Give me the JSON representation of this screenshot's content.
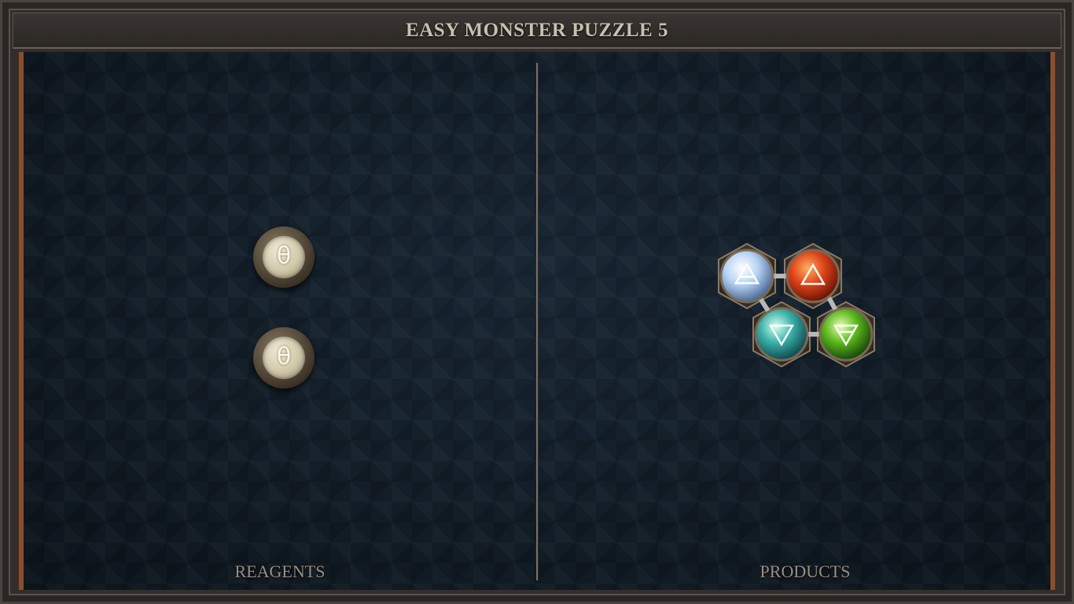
{
  "title": "EASY MONSTER PUZZLE 5",
  "panels": {
    "reagents_label": "REAGENTS",
    "products_label": "PRODUCTS"
  },
  "reagents": [
    {
      "glyph": "θ",
      "icon": "salt-glyph-icon",
      "color": "#e8e0c8"
    },
    {
      "glyph": "θ",
      "icon": "salt-glyph-icon",
      "color": "#e8e0c8"
    }
  ],
  "product_molecule": {
    "atoms": [
      {
        "element": "air",
        "icon": "air-triangle-icon",
        "color": "#a8c8f0"
      },
      {
        "element": "fire",
        "icon": "fire-triangle-icon",
        "color": "#e0441a"
      },
      {
        "element": "water",
        "icon": "water-triangle-icon",
        "color": "#3ab0a8"
      },
      {
        "element": "earth",
        "icon": "earth-triangle-icon",
        "color": "#5ab81e"
      }
    ],
    "bonds": [
      [
        "air",
        "fire"
      ],
      [
        "air",
        "water"
      ],
      [
        "fire",
        "earth"
      ],
      [
        "water",
        "earth"
      ]
    ]
  },
  "colors": {
    "board_bg": "#14202b",
    "board_edge": "#8a4f2a",
    "frame": "#2a2624",
    "title_text": "#c9bfb0",
    "label_text": "#9a8f84"
  }
}
